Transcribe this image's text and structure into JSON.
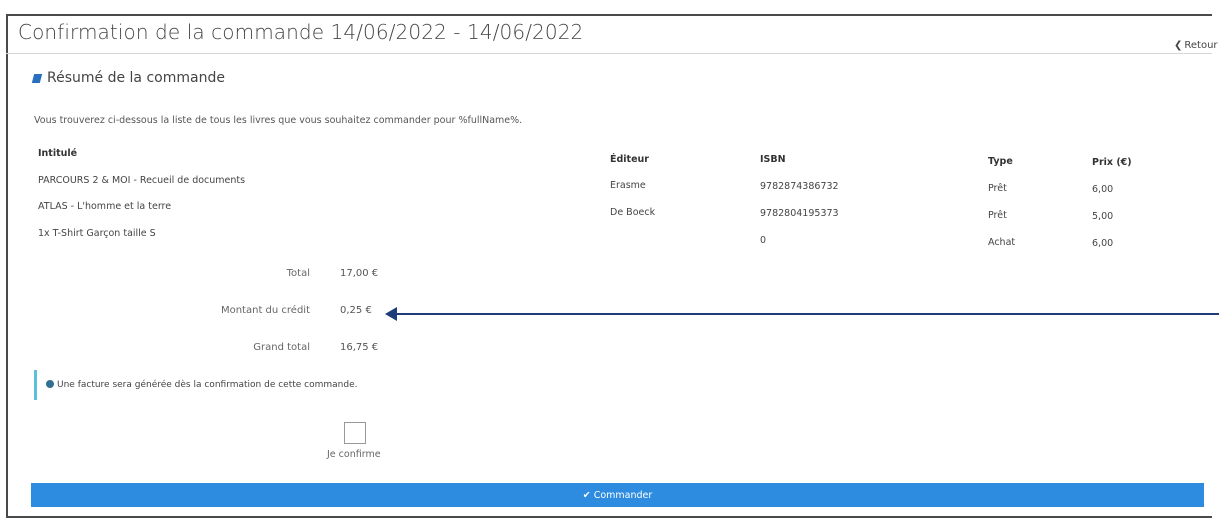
{
  "header": {
    "title": "Confirmation de la commande 14/06/2022 - 14/06/2022",
    "back_label": "Retour",
    "back_icon": "chevron-left-icon"
  },
  "summary": {
    "heading": "Résumé de la commande",
    "icon": "book-icon",
    "intro": "Vous trouverez ci-dessous la liste de tous les livres que vous souhaitez commander pour %fullName%."
  },
  "table": {
    "headers": {
      "title": "Intitulé",
      "publisher": "Éditeur",
      "isbn": "ISBN",
      "type": "Type",
      "price": "Prix (€)"
    },
    "titles": [
      "PARCOURS 2 & MOI - Recueil de documents",
      "ATLAS - L'homme et la terre",
      "1x T-Shirt Garçon taille S"
    ],
    "rows": [
      {
        "publisher": "Erasme",
        "isbn": "9782874386732",
        "type": "Prêt",
        "price": "6,00"
      },
      {
        "publisher": "De Boeck",
        "isbn": "9782804195373",
        "type": "Prêt",
        "price": "5,00"
      },
      {
        "publisher": "",
        "isbn": "0",
        "type": "Achat",
        "price": "6,00"
      }
    ]
  },
  "totals": {
    "total_label": "Total",
    "total_value": "17,00 €",
    "credit_label": "Montant du crédit",
    "credit_value": "0,25 €",
    "grand_label": "Grand total",
    "grand_value": "16,75 €"
  },
  "info": {
    "text": "Une facture sera générée dès la confirmation de cette commande.",
    "icon": "info-circle-icon"
  },
  "confirm": {
    "label": "Je confirme",
    "checked": false
  },
  "order_button": {
    "label": "Commander",
    "icon": "check-icon"
  },
  "colors": {
    "button": "#2d8ce0",
    "arrow": "#1f3b78",
    "info_border": "#5bc0de"
  }
}
